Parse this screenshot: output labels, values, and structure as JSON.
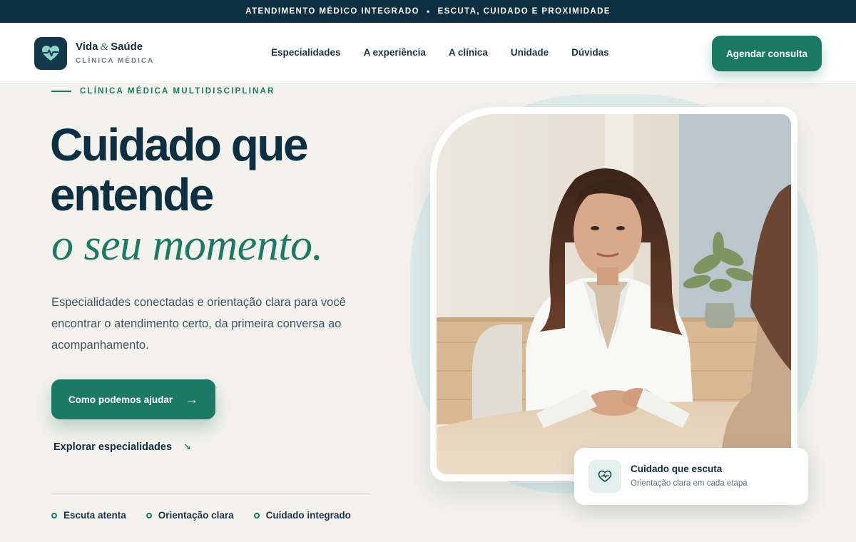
{
  "topbar": {
    "left": "ATENDIMENTO MÉDICO INTEGRADO",
    "separator": "•",
    "right": "ESCUTA, CUIDADO E PROXIMIDADE"
  },
  "brand": {
    "name_part1": "Vida",
    "ampersand": "&",
    "name_part2": "Saúde",
    "subtitle": "CLÍNICA MÉDICA",
    "logo_icon": "heart-pulse-icon"
  },
  "nav": {
    "items": [
      "Especialidades",
      "A experiência",
      "A clínica",
      "Unidade",
      "Dúvidas"
    ],
    "cta": "Agendar consulta"
  },
  "hero": {
    "eyebrow": "CLÍNICA MÉDICA MULTIDISCIPLINAR",
    "title_line1": "Cuidado que",
    "title_line2": "entende",
    "title_italic": "o seu momento.",
    "lead": "Especialidades conectadas e orientação clara para você encontrar o atendimento certo, da primeira conversa ao acompanhamento.",
    "cta_primary": "Como podemos ajudar",
    "cta_primary_icon": "arrow-right-icon",
    "cta_secondary": "Explorar especialidades",
    "cta_secondary_icon": "arrow-down-right-icon",
    "features": [
      "Escuta atenta",
      "Orientação clara",
      "Cuidado integrado"
    ]
  },
  "card": {
    "title": "Cuidado que escuta",
    "subtitle": "Orientação clara em cada etapa",
    "icon": "heart-pulse-icon"
  },
  "colors": {
    "navy": "#0c2f42",
    "green": "#1a7a64",
    "background": "#f4f2ec",
    "halo": "#dcecea"
  }
}
